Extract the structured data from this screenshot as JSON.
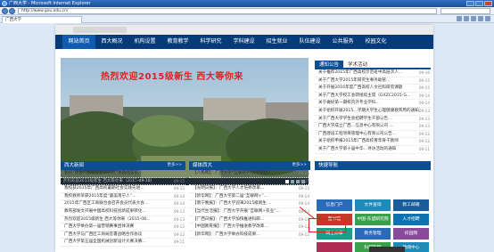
{
  "browser": {
    "title": "广西大学 - Microsoft Internet Explorer",
    "url": "http://www.gxu.edu.cn/",
    "tab_title": "广西大学"
  },
  "nav": [
    "网站首页",
    "西大概况",
    "机构设置",
    "教育教学",
    "科学研究",
    "学科建设",
    "招生就业",
    "队伍建设",
    "公共服务",
    "校园文化"
  ],
  "banner": {
    "headline": "热烈欢迎2015级新生  西大等你来",
    "caption": "热烈欢迎2015级新生 西大等你来（2015-08-10）"
  },
  "notices": {
    "tabs": [
      "通知公告",
      "学术活动"
    ],
    "items": [
      {
        "text": "关于推荐2015年广西高校示范班中高层次人…",
        "date": "09-16"
      },
      {
        "text": "关于广西大学2015年研究生事务助管…",
        "date": "09-15"
      },
      {
        "text": "关于开展2016年度广西高校人文社科研究课题",
        "date": "09-15"
      },
      {
        "text": "关于广西大学校工会转接续主席（GXZC2015-G…",
        "date": "09-14"
      },
      {
        "text": "关于做好第一期校内外专业学科…",
        "date": "09-14"
      },
      {
        "text": "关于组织开展2015…学期大学生心理健康教育周的通知",
        "date": "09-13"
      },
      {
        "text": "关于广西大学学生会招聘学生干部公告…",
        "date": "09-13"
      },
      {
        "text": "广西大学成立广西…信息中心有限公司 …",
        "date": "09-13"
      },
      {
        "text": "广西建设工程项目管理中心有限公司公告…",
        "date": "09-12"
      },
      {
        "text": "关于组织申报2015年广西高校青年骨干教师",
        "date": "09-12"
      },
      {
        "text": "关于广西大学第十届中华…寻访活动的通知",
        "date": "09-11"
      }
    ]
  },
  "news": {
    "title": "西大新闻",
    "more": "更多>>",
    "items": [
      {
        "text": "我校“建设广西新型智库研究”课题组成员…",
        "date": "09-16"
      },
      {
        "text": "葆留本色“互联网+”大学生创新创业大赛广…",
        "date": "09-15"
      },
      {
        "text": "我校获2015年广西高校暑期社会实践先进…",
        "date": "09-15"
      },
      {
        "text": "我校教师荣获2015年度“最美南宁人”…",
        "date": "09-14"
      },
      {
        "text": "2015年广西区工商联合会召开会员代表大会…",
        "date": "09-14"
      },
      {
        "text": "教育部发文开展中国高校科技创新成果转化…",
        "date": "09-13"
      },
      {
        "text": "热烈欢迎2015级新生 西大等你来（2015-08…",
        "date": "09-13"
      },
      {
        "text": "广西大学举办第一届营销赛事团体决赛",
        "date": "09-12"
      },
      {
        "text": "广西大学与广西区工商局签署战略合作协议",
        "date": "09-12"
      },
      {
        "text": "广西大学第五届全国机械创新设计大赛决赛…",
        "date": "09-11"
      }
    ]
  },
  "media": {
    "title": "媒体西大",
    "more": "更多>>",
    "items": [
      {
        "text": "【人民网】：广西大学“互联网+”大学生创…",
        "date": "09-16"
      },
      {
        "text": "【人民网】：广西大学电气工程学院举办…",
        "date": "09-15"
      },
      {
        "text": "【光明日报】：广西大学人才培养改革…",
        "date": "09-15"
      },
      {
        "text": "【新华网】：广西大学第二届“互联网+”…",
        "date": "09-14"
      },
      {
        "text": "【南宁晚报】：广西大学迎来2015级新生…",
        "date": "09-14"
      },
      {
        "text": "【当代生活报】：广西大学开展“互联网+农业”…",
        "date": "09-13"
      },
      {
        "text": "【广西日报】：广西大学加快推进科研…",
        "date": "09-13"
      },
      {
        "text": "【中国教育报】：广西大学推进教学改革…",
        "date": "09-12"
      },
      {
        "text": "【新华网】：广西大学举办科技成果…",
        "date": "09-12"
      }
    ]
  },
  "quick": {
    "title": "快捷导航",
    "buttons": [
      {
        "label": "信息门户",
        "color": "#2a6bb8"
      },
      {
        "label": "文件查询",
        "color": "#1f8ab8"
      },
      {
        "label": "教工邮箱",
        "color": "#1b5d99"
      },
      {
        "label": "图书馆",
        "color": "#c43a2a"
      },
      {
        "label": "中国-东盟研究院",
        "color": "#3aa04a"
      },
      {
        "label": "人才招聘",
        "color": "#0e72b0"
      },
      {
        "label": "网上办事",
        "color": "#1f9b87"
      },
      {
        "label": "教务管理",
        "color": "#2a6bb8"
      },
      {
        "label": "校园网",
        "color": "#8a4a9c"
      },
      {
        "label": "",
        "color": "#b02b55"
      },
      {
        "label": "科研管理",
        "color": "#3aa04a"
      },
      {
        "label": "新闻中心",
        "color": "#1f8ab8"
      }
    ]
  }
}
